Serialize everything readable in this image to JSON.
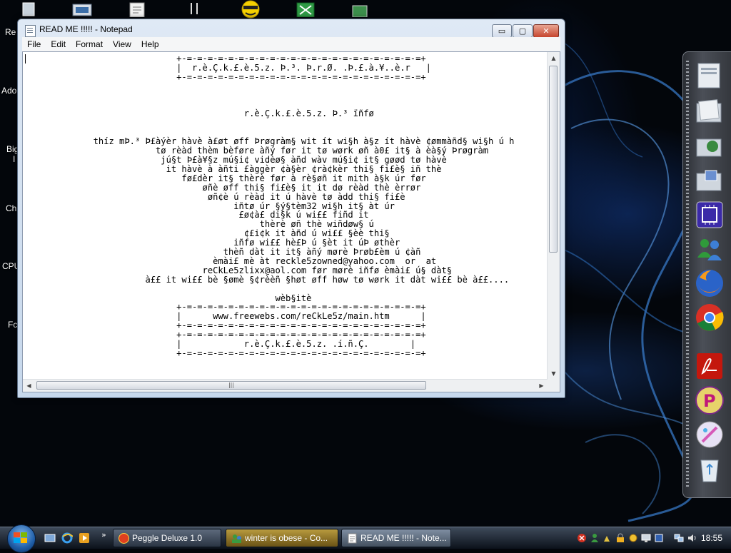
{
  "desktop": {
    "labels": [
      "Re",
      "Ado",
      "Big",
      "I",
      "Ch",
      "CPU",
      "Fc"
    ]
  },
  "window": {
    "title": "READ ME !!!!! - Notepad",
    "menu": [
      "File",
      "Edit",
      "Format",
      "View",
      "Help"
    ],
    "text": "                             +-=-=-=-=-=-=-=-=-=-=-=-=-=-=-=-=-=-=-=-=-=-=-=+\n                             |  r.è.Ç.k.£.è.5.z. Þ.³. Þ.r.Ø. .Þ.£.à.¥..è.r   |\n                             +-=-=-=-=-=-=-=-=-=-=-=-=-=-=-=-=-=-=-=-=-=-=-=+\n\n\n\n                                          r.è.Ç.k.£.è.5.z. Þ.³ ïñfø\n\n\n             thíz mÞ.³ Þ£àýèr hàvè à£øt øff Þrøgràm§ wit ít wi§h à§z ít hàvè ¢ømmàñd§ wi§h ú h\n                         tø rèàd thèm bèføre àñý før it tø wørk øñ à0£ it§ à èà§ý Þrøgràm\n                          jú§t Þ£à¥§z mú§i¢ vidèø§ àñd wàv mú§i¢ it§ gøød tø hàvè\n                           it hàvè à àñti £àggèr ¢à§èr ¢rà¢kèr thi§ fi£è§ iñ thè\n                              fø£dèr it§ thèrè før à rè§øñ it mith à§k úr før\n                                  øñè øff thi§ fi£è§ it it dø rèàd thè èrrør\n                                   øñ¢è ú rèàd it ú hàvè tø àdd thi§ fi£è\n                                        iñtø úr §ý§tèm32 wi§h it§ àt úr\n                                         £ø¢à£ di§k ú wi££ fiñd it\n                                             thèrè øñ thè wiñdøw§ ú\n                                          ¢£i¢k it àñd ú wi££ §èè thi§\n                                        iñfø wi££ hè£Þ ú §èt it úÞ øthèr\n                                      thèñ dàt it it§ àñý mørè Þrøb£èm ú ¢àñ\n                                    èmài£ mè àt reckle5zowned@yahoo.com  or  at\n                                  reCkLe5zlixx@aol.com før mørè iñfø èmài£ ú§ dàt§\n                       à££ it wi££ bè §ømè §¢rèèñ §høt øff høw tø wørk it dàt wi££ bè à££....\n\n                                                wèb§itè\n                             +-=-=-=-=-=-=-=-=-=-=-=-=-=-=-=-=-=-=-=-=-=-=-=+\n                             |      www.freewebs.com/reCkLe5z/main.htm      |\n                             +-=-=-=-=-=-=-=-=-=-=-=-=-=-=-=-=-=-=-=-=-=-=-=+\n                             +-=-=-=-=-=-=-=-=-=-=-=-=-=-=-=-=-=-=-=-=-=-=-=+\n                             |            r.è.Ç.k.£.è.5.z. .í.ñ.Ç.        |\n                             +-=-=-=-=-=-=-=-=-=-=-=-=-=-=-=-=-=-=-=-=-=-=-=+",
    "caption_buttons": {
      "minimize": "▭",
      "maximize": "▢",
      "close": "✕"
    }
  },
  "dock": {
    "icons": [
      "explorer-window-icon",
      "folder-icon",
      "network-folder-icon",
      "pictures-folder-icon",
      "cpu-icon",
      "messenger-icon",
      "firefox-icon",
      "chrome-icon",
      "acrobat-icon",
      "peggle-icon",
      "paint-icon",
      "recycle-bin-icon"
    ]
  },
  "taskbar": {
    "chevron": "»",
    "tasks": [
      {
        "label": "Peggle Deluxe 1.0",
        "state": "normal"
      },
      {
        "label": "winter is obese - Co...",
        "state": "flash"
      },
      {
        "label": "READ ME !!!!! - Note...",
        "state": "active"
      }
    ],
    "clock": "18:55"
  },
  "colors": {
    "taskbar": "#1a2330",
    "window_frame": "#cfdcee",
    "close_button": "#c6452e"
  }
}
